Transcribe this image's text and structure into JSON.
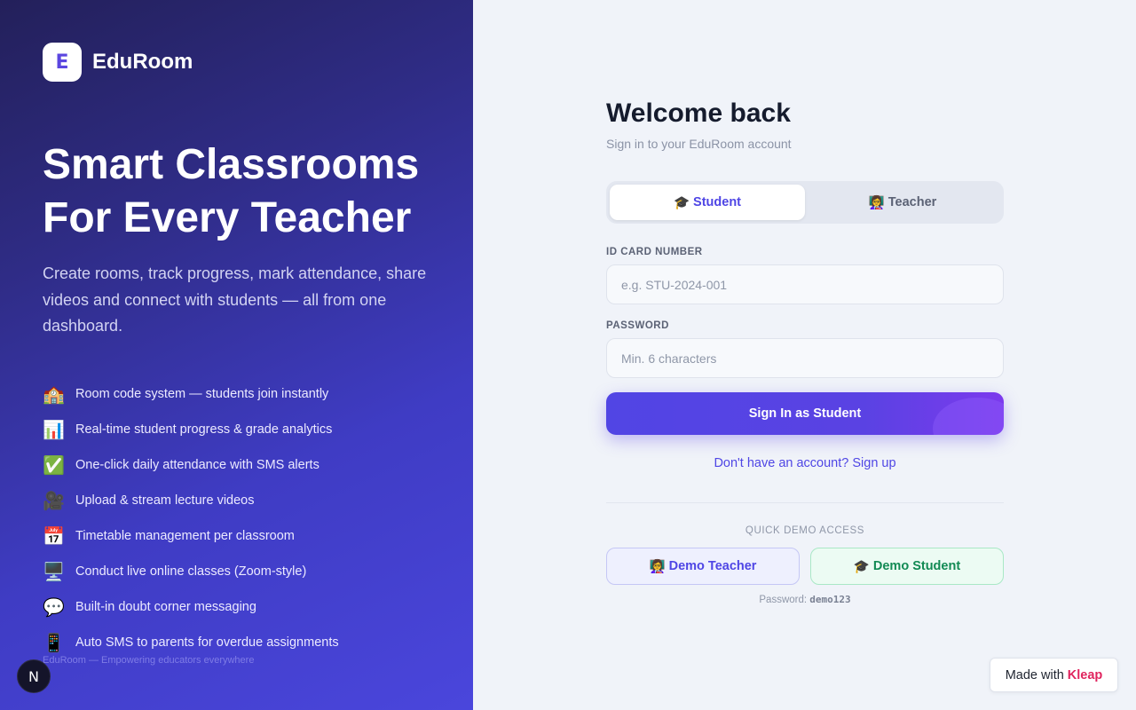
{
  "brand": {
    "logo_letter": "E",
    "name": "EduRoom",
    "primary_color": "#4f46e5",
    "logo_icon": "eduroom-logo-icon"
  },
  "hero": {
    "title_line1": "Smart Classrooms",
    "title_line2": "For Every Teacher",
    "subtitle": "Create rooms, track progress, mark attendance, share videos and connect with students — all from one dashboard."
  },
  "features": [
    {
      "icon": "🏫",
      "icon_name": "school-icon",
      "text": "Room code system — students join instantly"
    },
    {
      "icon": "📊",
      "icon_name": "bar-chart-icon",
      "text": "Real-time student progress & grade analytics"
    },
    {
      "icon": "✅",
      "icon_name": "check-icon",
      "text": "One-click daily attendance with SMS alerts"
    },
    {
      "icon": "🎥",
      "icon_name": "video-camera-icon",
      "text": "Upload & stream lecture videos"
    },
    {
      "icon": "📅",
      "icon_name": "calendar-icon",
      "text": "Timetable management per classroom"
    },
    {
      "icon": "🖥️",
      "icon_name": "monitor-icon",
      "text": "Conduct live online classes (Zoom-style)"
    },
    {
      "icon": "💬",
      "icon_name": "chat-bubble-icon",
      "text": "Built-in doubt corner messaging"
    },
    {
      "icon": "📱",
      "icon_name": "mobile-phone-icon",
      "text": "Auto SMS to parents for overdue assignments"
    }
  ],
  "footer_note": "EduRoom — Empowering educators everywhere",
  "n_badge": "N",
  "form": {
    "title": "Welcome back",
    "subtitle": "Sign in to your EduRoom account",
    "tabs": [
      {
        "icon": "🎓",
        "label": "Student",
        "active": true
      },
      {
        "icon": "👩‍🏫",
        "label": "Teacher",
        "active": false
      }
    ],
    "id_label": "ID CARD NUMBER",
    "id_placeholder": "e.g. STU-2024-001",
    "id_value": "",
    "password_label": "PASSWORD",
    "password_placeholder": "Min. 6 characters",
    "password_value": "",
    "submit_label": "Sign In as Student",
    "signup_link": "Don't have an account? Sign up",
    "quick_demo_label": "QUICK DEMO ACCESS",
    "demo_teacher": {
      "icon": "👩‍🏫",
      "label": "Demo Teacher"
    },
    "demo_student": {
      "icon": "🎓",
      "label": "Demo Student"
    },
    "password_hint_label": "Password:",
    "password_hint_value": "demo123"
  },
  "made_with": {
    "prefix": "Made with",
    "brand": "Kleap"
  }
}
